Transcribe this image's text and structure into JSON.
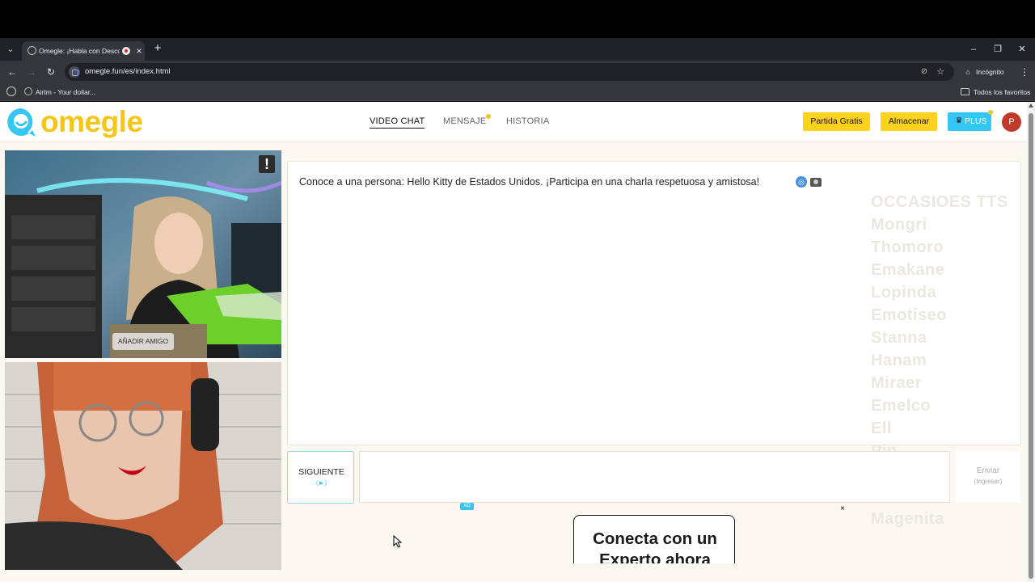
{
  "browser": {
    "tab_title": "Omegle: ¡Habla con Desconocidos!",
    "url": "omegle.fun/es/index.html",
    "incognito_label": "Incógnito",
    "bookmark_label": "Airtm - Your dollar...",
    "all_bookmarks_label": "Todos los favoritos",
    "tab_close": "×",
    "new_tab": "+",
    "window_controls": [
      "–",
      "❐",
      "✕"
    ]
  },
  "site": {
    "logo_text": "omegle",
    "nav": [
      {
        "label": "VIDEO CHAT",
        "active": true
      },
      {
        "label": "MENSAJE",
        "active": false
      },
      {
        "label": "HISTORIA",
        "active": false
      }
    ],
    "btn_free_game": "Partida Gratis",
    "btn_store": "Almacenar",
    "btn_plus": "PLUS",
    "avatar_initial": "P",
    "colors": {
      "brand_yellow": "#f5c518",
      "accent_blue": "#36c6f4"
    }
  },
  "video": {
    "report_label": "!",
    "add_friend_label": "AÑADIR AMIGO"
  },
  "chat": {
    "message": "Conoce a una persona: Hello Kitty de Estados Unidos. ¡Participa en una charla respetuosa y amistosa!",
    "next_label": "SIGUIENTE",
    "next_sub": "(►)",
    "send_label": "Enviar",
    "send_sub": "(Ingresar)",
    "input_placeholder": ""
  },
  "ad": {
    "badge": "AD",
    "close": "×",
    "headline": "Conecta con un Experto ahora"
  }
}
